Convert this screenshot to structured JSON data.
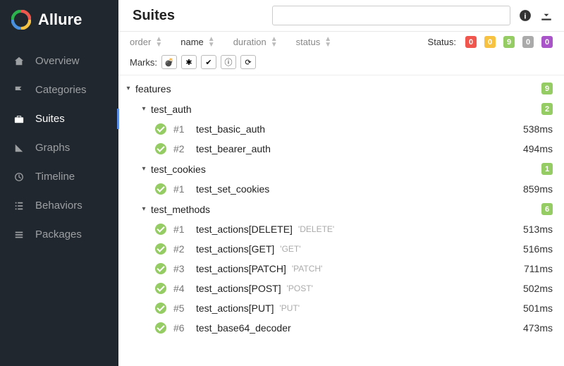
{
  "brand": {
    "name": "Allure"
  },
  "sidebar": {
    "items": [
      {
        "label": "Overview",
        "icon": "home-icon"
      },
      {
        "label": "Categories",
        "icon": "flag-icon"
      },
      {
        "label": "Suites",
        "icon": "briefcase-icon",
        "active": true
      },
      {
        "label": "Graphs",
        "icon": "chart-icon"
      },
      {
        "label": "Timeline",
        "icon": "clock-icon"
      },
      {
        "label": "Behaviors",
        "icon": "list-icon"
      },
      {
        "label": "Packages",
        "icon": "package-icon"
      }
    ]
  },
  "page": {
    "title": "Suites"
  },
  "search": {
    "placeholder": ""
  },
  "sorters": {
    "order": "order",
    "name": "name",
    "duration": "duration",
    "status": "status"
  },
  "status_summary": {
    "label": "Status:",
    "failed": "0",
    "broken": "0",
    "passed": "9",
    "skipped": "0",
    "unknown": "0"
  },
  "marks": {
    "label": "Marks:"
  },
  "tree": {
    "root": {
      "name": "features",
      "count": "9"
    },
    "suites": [
      {
        "name": "test_auth",
        "count": "2",
        "tests": [
          {
            "idx": "#1",
            "name": "test_basic_auth",
            "duration": "538ms"
          },
          {
            "idx": "#2",
            "name": "test_bearer_auth",
            "duration": "494ms"
          }
        ]
      },
      {
        "name": "test_cookies",
        "count": "1",
        "tests": [
          {
            "idx": "#1",
            "name": "test_set_cookies",
            "duration": "859ms"
          }
        ]
      },
      {
        "name": "test_methods",
        "count": "6",
        "tests": [
          {
            "idx": "#1",
            "name": "test_actions[DELETE]",
            "param": "'DELETE'",
            "duration": "513ms"
          },
          {
            "idx": "#2",
            "name": "test_actions[GET]",
            "param": "'GET'",
            "duration": "516ms"
          },
          {
            "idx": "#3",
            "name": "test_actions[PATCH]",
            "param": "'PATCH'",
            "duration": "711ms"
          },
          {
            "idx": "#4",
            "name": "test_actions[POST]",
            "param": "'POST'",
            "duration": "502ms"
          },
          {
            "idx": "#5",
            "name": "test_actions[PUT]",
            "param": "'PUT'",
            "duration": "501ms"
          },
          {
            "idx": "#6",
            "name": "test_base64_decoder",
            "duration": "473ms"
          }
        ]
      }
    ]
  }
}
